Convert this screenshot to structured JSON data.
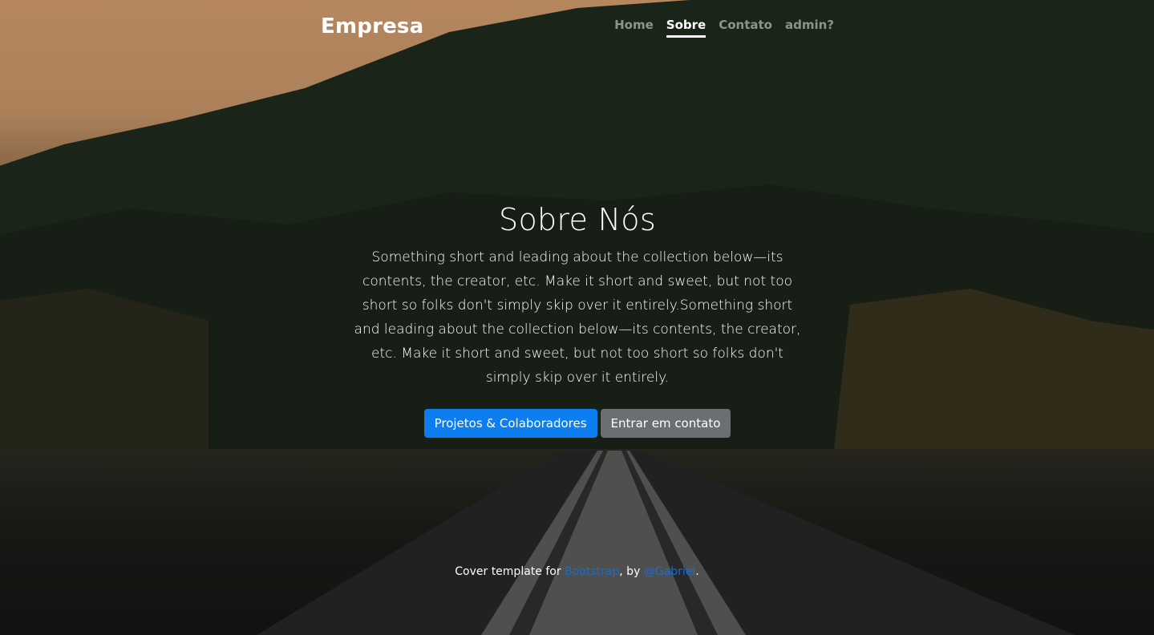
{
  "brand": "Empresa",
  "nav": {
    "home": "Home",
    "sobre": "Sobre",
    "contato": "Contato",
    "admin": "admin?"
  },
  "cover": {
    "title": "Sobre Nós",
    "lead": "Something short and leading about the collection below—its contents, the creator, etc. Make it short and sweet, but not too short so folks don't simply skip over it entirely.Something short and leading about the collection below—its contents, the creator, etc. Make it short and sweet, but not too short so folks don't simply skip over it entirely.",
    "primary_button": "Projetos & Colaboradores",
    "secondary_button": "Entrar em contato"
  },
  "footer": {
    "prefix": "Cover template for ",
    "link1": "Bootstrap",
    "middle": ", by ",
    "link2": "@Gabriel",
    "suffix": "."
  },
  "colors": {
    "primary": "#0d7ef0",
    "secondary": "#6b6e72",
    "link": "#1a6bd6"
  }
}
